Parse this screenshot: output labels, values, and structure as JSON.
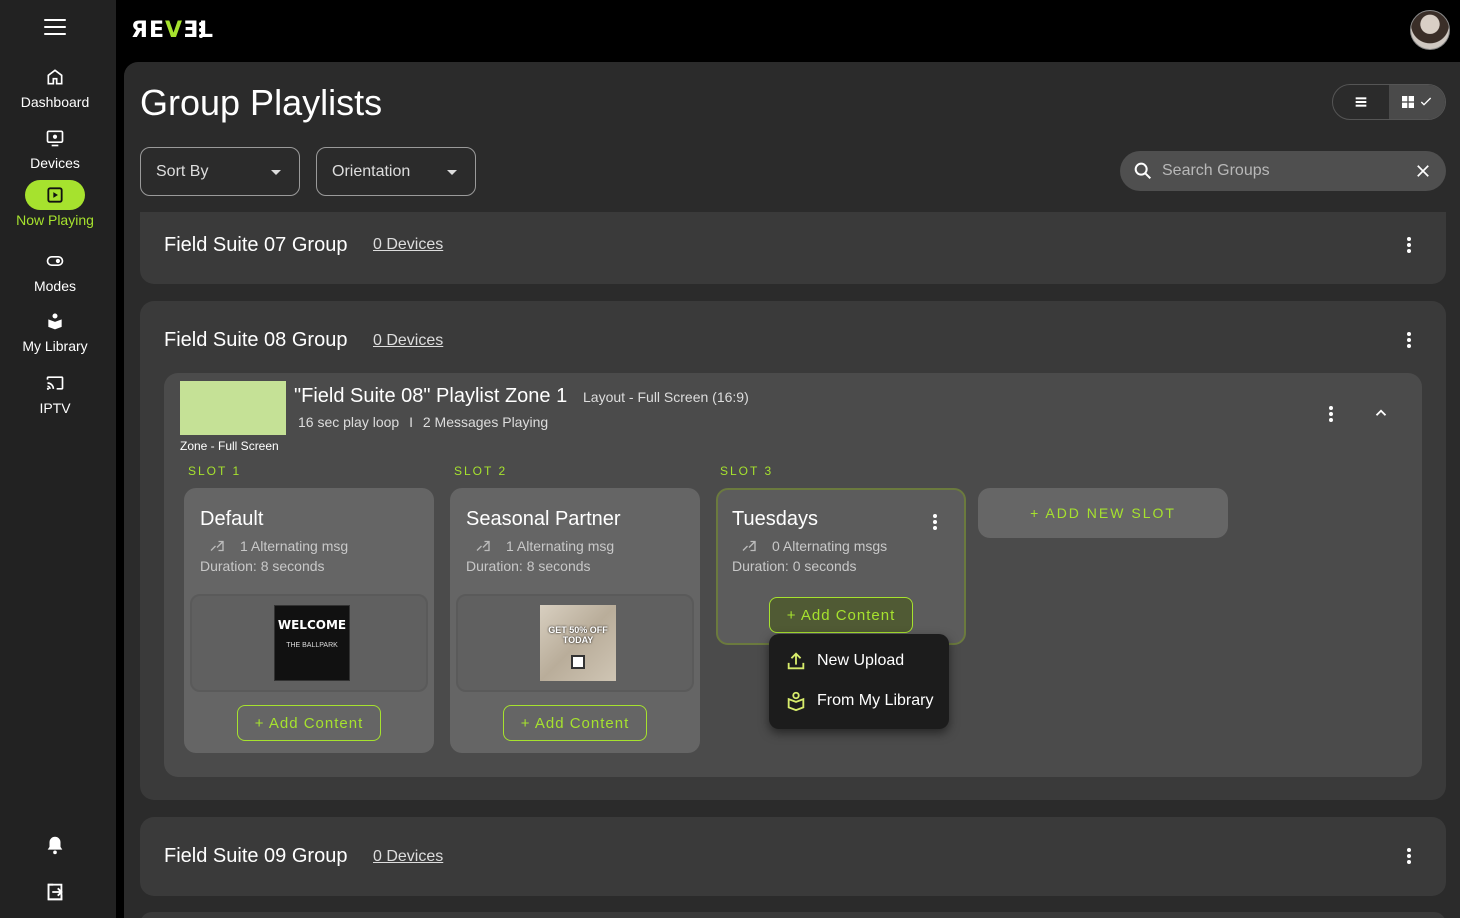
{
  "app": {
    "logo_prefix": "ЯE",
    "logo_v": "V",
    "logo_suffix": "ƎL"
  },
  "sidebar": {
    "items": [
      {
        "label": "Dashboard",
        "icon": "home-icon",
        "active": false
      },
      {
        "label": "Devices",
        "icon": "display-icon",
        "active": false
      },
      {
        "label": "Now Playing",
        "icon": "play-box-icon",
        "active": true
      },
      {
        "label": "Modes",
        "icon": "toggle-icon",
        "active": false
      },
      {
        "label": "My Library",
        "icon": "library-icon",
        "active": false
      },
      {
        "label": "IPTV",
        "icon": "cast-icon",
        "active": false
      }
    ],
    "bottom_icons": [
      "bell-icon",
      "logout-icon"
    ]
  },
  "page": {
    "title": "Group Playlists"
  },
  "filters": {
    "sort_by": "Sort By",
    "orientation": "Orientation",
    "search_placeholder": "Search Groups"
  },
  "groups": [
    {
      "name": "Field Suite 07 Group",
      "devices": "0 Devices"
    },
    {
      "name": "Field Suite 08 Group",
      "devices": "0 Devices"
    },
    {
      "name": "Field Suite 09 Group",
      "devices": "0 Devices"
    }
  ],
  "zone": {
    "title": "\"Field Suite 08\" Playlist Zone 1",
    "layout": "Layout - Full Screen (16:9)",
    "loop": "16 sec play loop",
    "separator": "I",
    "messages": "2 Messages Playing",
    "thumb_label": "Zone - Full Screen",
    "thumb_color": "#c5e196"
  },
  "slots": [
    {
      "label": "SLOT 1",
      "title": "Default",
      "alternating": "1 Alternating msg",
      "duration": "Duration: 8 seconds",
      "thumb_text": "WELCOME",
      "thumb_sub": "THE BALLPARK",
      "add_label": "+ Add Content"
    },
    {
      "label": "SLOT 2",
      "title": "Seasonal Partner",
      "alternating": "1 Alternating msg",
      "duration": "Duration: 8 seconds",
      "thumb_text": "GET 50% OFF TODAY",
      "add_label": "+ Add Content"
    },
    {
      "label": "SLOT 3",
      "title": "Tuesdays",
      "alternating": "0 Alternating msgs",
      "duration": "Duration: 0 seconds",
      "add_label": "+ Add Content"
    }
  ],
  "add_slot": "+ ADD NEW SLOT",
  "menu": {
    "new_upload": "New Upload",
    "from_library": "From My Library"
  },
  "colors": {
    "accent": "#a6e22e",
    "sidebar": "#222222",
    "panel": "#2b2b2b"
  }
}
